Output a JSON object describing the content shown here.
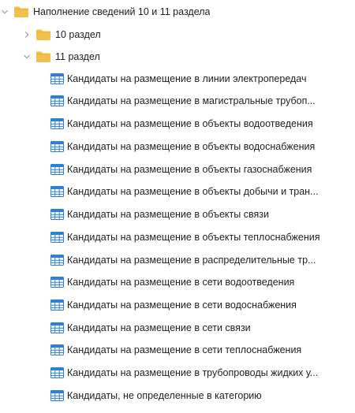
{
  "tree": {
    "root": {
      "label": "Наполнение сведений 10 и 11 раздела",
      "expanded": true,
      "icon": "folder-icon",
      "children": [
        {
          "label": "10 раздел",
          "expanded": false,
          "icon": "folder-icon"
        },
        {
          "label": "11 раздел",
          "expanded": true,
          "icon": "folder-icon",
          "items": [
            {
              "label": "Кандидаты на размещение в линии электропередач",
              "icon": "table-icon"
            },
            {
              "label": "Кандидаты на размещение в магистральные трубоп...",
              "icon": "table-icon"
            },
            {
              "label": "Кандидаты на размещение в объекты водоотведения",
              "icon": "table-icon"
            },
            {
              "label": "Кандидаты на размещение в объекты водоснабжения",
              "icon": "table-icon"
            },
            {
              "label": "Кандидаты на размещение в объекты газоснабжения",
              "icon": "table-icon"
            },
            {
              "label": "Кандидаты на размещение в объекты добычи и тран...",
              "icon": "table-icon"
            },
            {
              "label": "Кандидаты на размещение в объекты связи",
              "icon": "table-icon"
            },
            {
              "label": "Кандидаты на размещение в объекты теплоснабжения",
              "icon": "table-icon"
            },
            {
              "label": "Кандидаты на размещение в распределительные тр...",
              "icon": "table-icon"
            },
            {
              "label": "Кандидаты на размещение в сети водоотведения",
              "icon": "table-icon"
            },
            {
              "label": "Кандидаты на размещение в сети водоснабжения",
              "icon": "table-icon"
            },
            {
              "label": "Кандидаты на размещение в сети связи",
              "icon": "table-icon"
            },
            {
              "label": "Кандидаты на размещение в сети теплоснабжения",
              "icon": "table-icon"
            },
            {
              "label": "Кандидаты на размещение в трубопроводы жидких у...",
              "icon": "table-icon"
            },
            {
              "label": "Кандидаты, не определенные в категорию",
              "icon": "table-icon"
            }
          ]
        }
      ]
    }
  },
  "colors": {
    "folder": "#f0c14b",
    "folder_tab": "#e5ad2d",
    "table_icon": "#2f7fd2",
    "chevron": "#9e9e9e",
    "text": "#1f1f1f"
  }
}
